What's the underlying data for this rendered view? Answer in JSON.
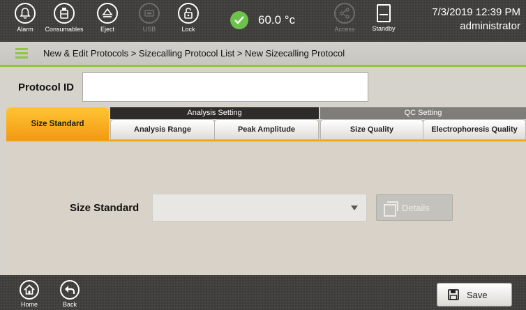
{
  "topbar": {
    "alarm_label": "Alarm",
    "consumables_label": "Consumables",
    "eject_label": "Eject",
    "usb_label": "USB",
    "lock_label": "Lock",
    "temperature": "60.0 °c",
    "access_label": "Access",
    "standby_label": "Standby",
    "datetime": "7/3/2019 12:39 PM",
    "user": "administrator"
  },
  "breadcrumb": "New & Edit Protocols > Sizecalling Protocol List > New Sizecalling Protocol",
  "protocol_id": {
    "label": "Protocol ID",
    "value": ""
  },
  "tabs": {
    "size_standard": "Size Standard",
    "analysis_group": "Analysis Setting",
    "qc_group": "QC Setting",
    "analysis_range": "Analysis Range",
    "peak_amplitude": "Peak Amplitude",
    "size_quality": "Size Quality",
    "electrophoresis_quality": "Electrophoresis Quality"
  },
  "form": {
    "size_standard_label": "Size Standard",
    "size_standard_value": "",
    "details_label": "Details"
  },
  "bottombar": {
    "home_label": "Home",
    "back_label": "Back",
    "save_label": "Save"
  },
  "colors": {
    "accent_orange": "#f39a13",
    "accent_green": "#8fc445",
    "status_ok": "#6cc24a"
  }
}
